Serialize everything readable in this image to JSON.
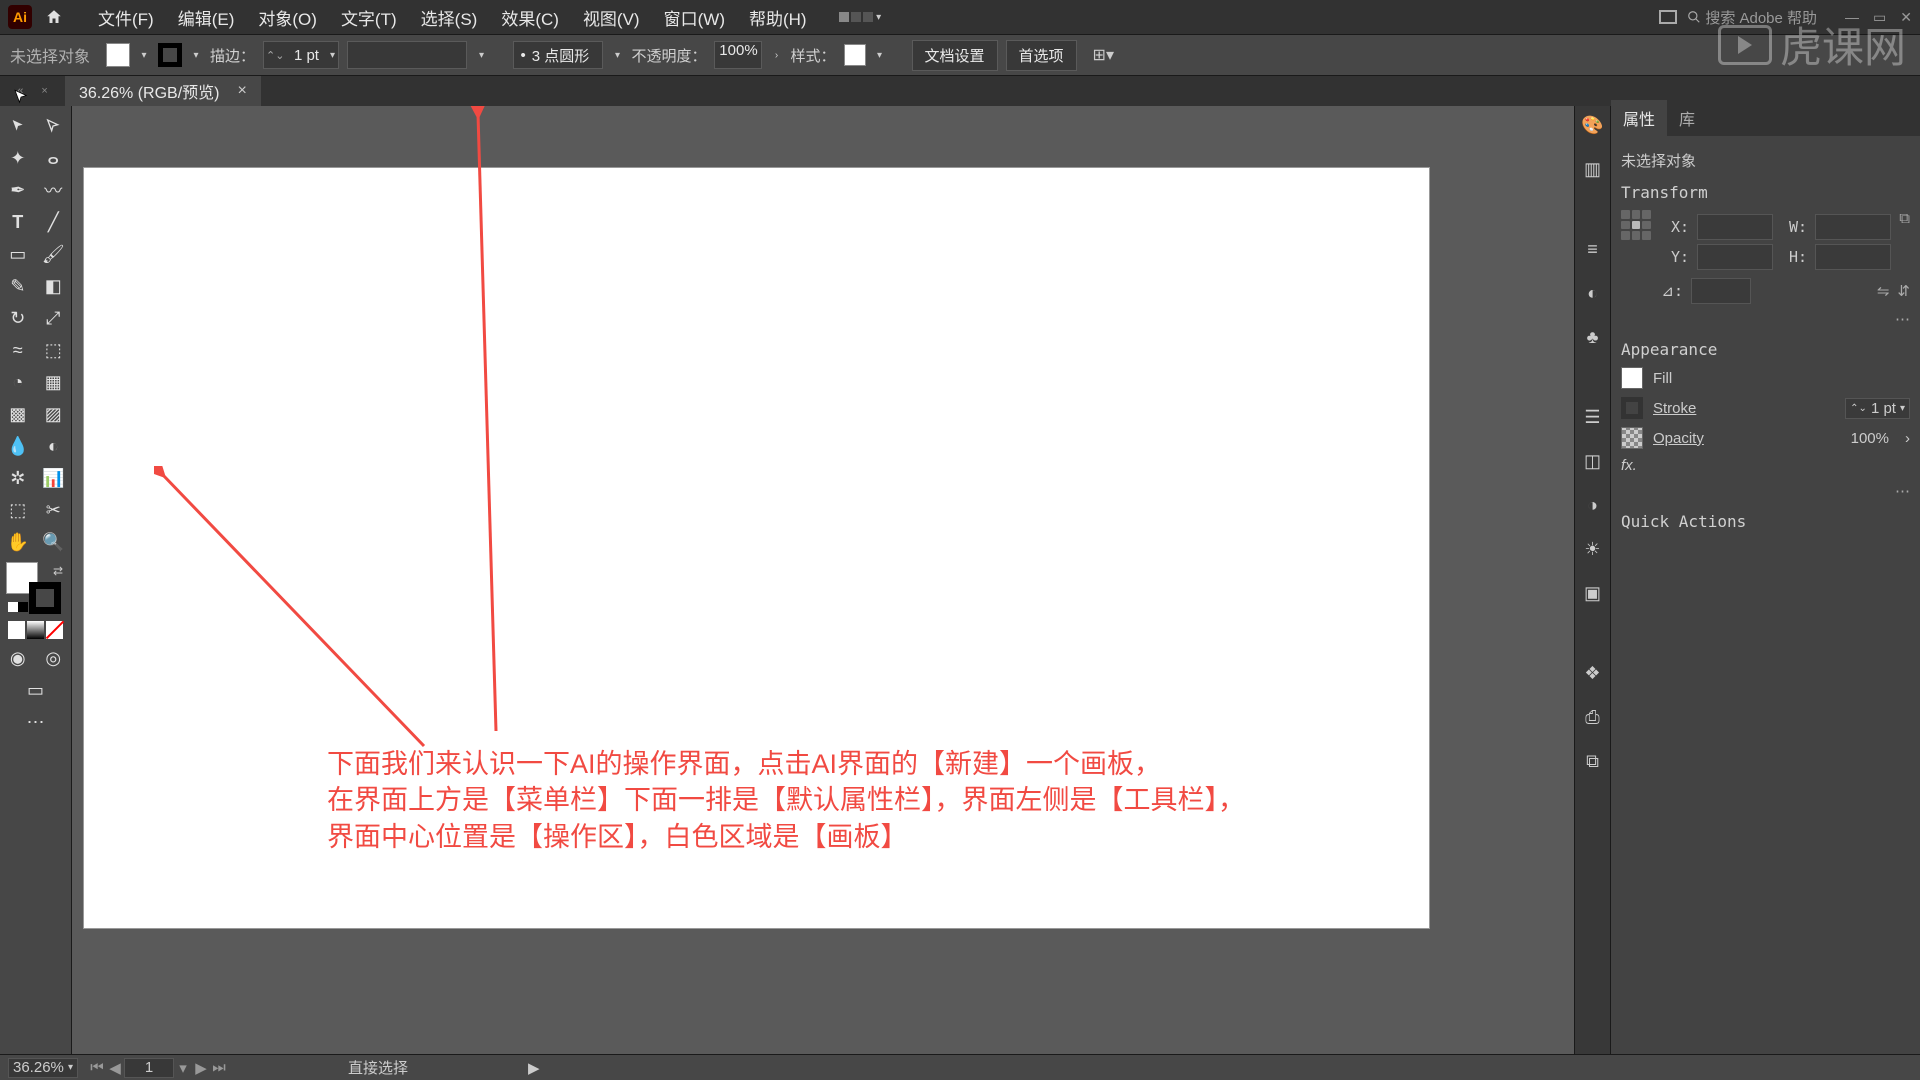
{
  "menu": {
    "file": "文件(F)",
    "edit": "编辑(E)",
    "object": "对象(O)",
    "type": "文字(T)",
    "select": "选择(S)",
    "effect": "效果(C)",
    "view": "视图(V)",
    "window": "窗口(W)",
    "help": "帮助(H)"
  },
  "search_placeholder": "搜索 Adobe 帮助",
  "control": {
    "no_selection": "未选择对象",
    "stroke_label": "描边：",
    "stroke_weight": "1 pt",
    "brush_preset": "3 点圆形",
    "opacity_label": "不透明度：",
    "opacity_value": "100%",
    "style_label": "样式：",
    "doc_setup": "文档设置",
    "prefs": "首选项"
  },
  "tab": {
    "title": "36.26% (RGB/预览)"
  },
  "zoom": "36.26%",
  "artboard_nav": "1",
  "status_tool": "直接选择",
  "panel": {
    "properties": "属性",
    "library": "库",
    "no_sel": "未选择对象",
    "transform": "Transform",
    "x": "X:",
    "y": "Y:",
    "w": "W:",
    "h": "H:",
    "angle": "⊿:",
    "appearance": "Appearance",
    "fill": "Fill",
    "stroke": "Stroke",
    "stroke_val": "1 pt",
    "opacity": "Opacity",
    "op_val": "100%",
    "fx": "fx.",
    "quick": "Quick Actions"
  },
  "annotation": {
    "l1": "下面我们来认识一下AI的操作界面，点击AI界面的【新建】一个画板，",
    "l2": "在界面上方是【菜单栏】下面一排是【默认属性栏】，界面左侧是【工具栏】，",
    "l3": "界面中心位置是【操作区】，白色区域是【画板】"
  },
  "watermark": "虎课网",
  "dot": "•"
}
